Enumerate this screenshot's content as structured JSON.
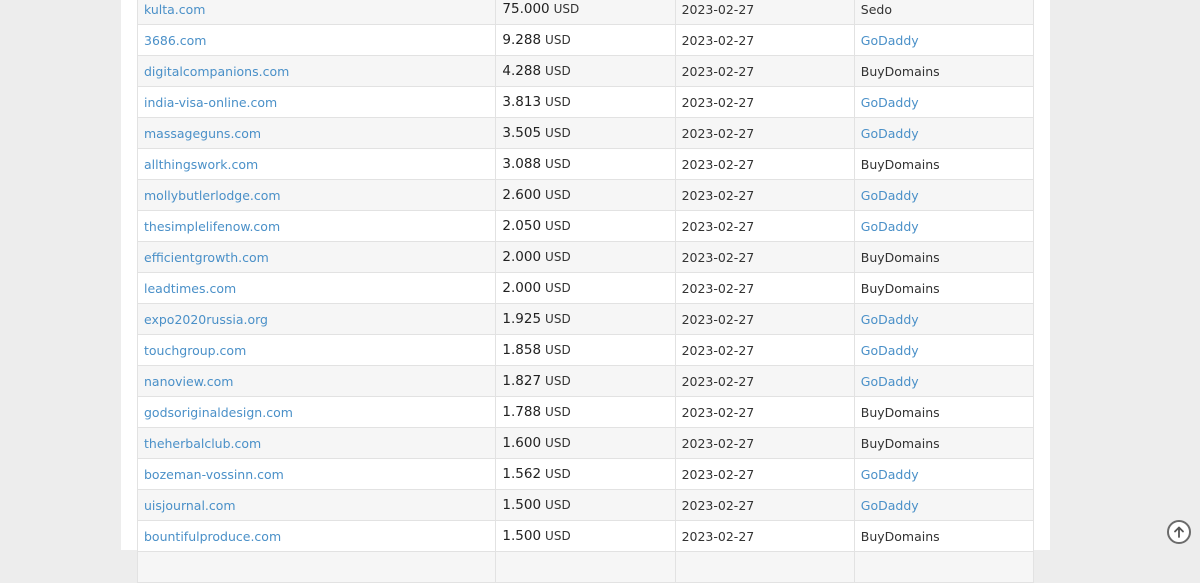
{
  "sales": {
    "rows": [
      {
        "domain": "kulta.com",
        "amount": "75.000",
        "currency": "USD",
        "date": "2023-02-27",
        "venue": "Sedo"
      },
      {
        "domain": "3686.com",
        "amount": "9.288",
        "currency": "USD",
        "date": "2023-02-27",
        "venue": "GoDaddy"
      },
      {
        "domain": "digitalcompanions.com",
        "amount": "4.288",
        "currency": "USD",
        "date": "2023-02-27",
        "venue": "BuyDomains"
      },
      {
        "domain": "india-visa-online.com",
        "amount": "3.813",
        "currency": "USD",
        "date": "2023-02-27",
        "venue": "GoDaddy"
      },
      {
        "domain": "massageguns.com",
        "amount": "3.505",
        "currency": "USD",
        "date": "2023-02-27",
        "venue": "GoDaddy"
      },
      {
        "domain": "allthingswork.com",
        "amount": "3.088",
        "currency": "USD",
        "date": "2023-02-27",
        "venue": "BuyDomains"
      },
      {
        "domain": "mollybutlerlodge.com",
        "amount": "2.600",
        "currency": "USD",
        "date": "2023-02-27",
        "venue": "GoDaddy"
      },
      {
        "domain": "thesimplelifenow.com",
        "amount": "2.050",
        "currency": "USD",
        "date": "2023-02-27",
        "venue": "GoDaddy"
      },
      {
        "domain": "efficientgrowth.com",
        "amount": "2.000",
        "currency": "USD",
        "date": "2023-02-27",
        "venue": "BuyDomains"
      },
      {
        "domain": "leadtimes.com",
        "amount": "2.000",
        "currency": "USD",
        "date": "2023-02-27",
        "venue": "BuyDomains"
      },
      {
        "domain": "expo2020russia.org",
        "amount": "1.925",
        "currency": "USD",
        "date": "2023-02-27",
        "venue": "GoDaddy"
      },
      {
        "domain": "touchgroup.com",
        "amount": "1.858",
        "currency": "USD",
        "date": "2023-02-27",
        "venue": "GoDaddy"
      },
      {
        "domain": "nanoview.com",
        "amount": "1.827",
        "currency": "USD",
        "date": "2023-02-27",
        "venue": "GoDaddy"
      },
      {
        "domain": "godsoriginaldesign.com",
        "amount": "1.788",
        "currency": "USD",
        "date": "2023-02-27",
        "venue": "BuyDomains"
      },
      {
        "domain": "theherbalclub.com",
        "amount": "1.600",
        "currency": "USD",
        "date": "2023-02-27",
        "venue": "BuyDomains"
      },
      {
        "domain": "bozeman-vossinn.com",
        "amount": "1.562",
        "currency": "USD",
        "date": "2023-02-27",
        "venue": "GoDaddy"
      },
      {
        "domain": "uisjournal.com",
        "amount": "1.500",
        "currency": "USD",
        "date": "2023-02-27",
        "venue": "GoDaddy"
      },
      {
        "domain": "bountifulproduce.com",
        "amount": "1.500",
        "currency": "USD",
        "date": "2023-02-27",
        "venue": "BuyDomains"
      },
      {
        "domain": "",
        "amount": "",
        "currency": "",
        "date": "",
        "venue": ""
      }
    ]
  },
  "linked_venues": [
    "GoDaddy"
  ],
  "colors": {
    "link": "#4a90c8",
    "text": "#333333",
    "row_alt": "#f6f6f6",
    "border": "#e2e2e2",
    "page_bg": "#ededed"
  },
  "scroll_top": {
    "icon": "arrow-up-circle-icon"
  }
}
